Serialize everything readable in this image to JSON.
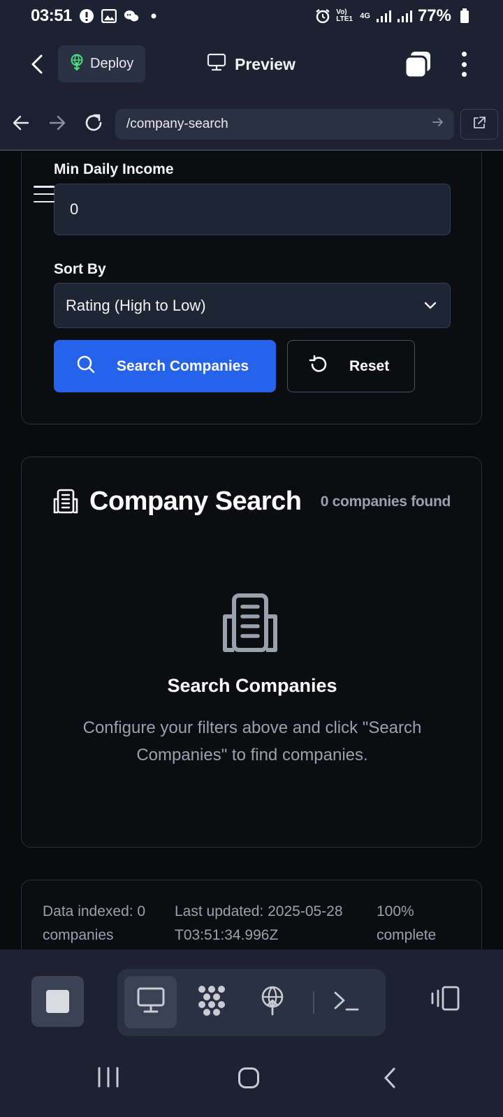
{
  "status_bar": {
    "time": "03:51",
    "signal_label": "Vo) LTE1",
    "network_type": "4G",
    "battery": "77%"
  },
  "app_header": {
    "deploy_label": "Deploy",
    "preview_label": "Preview"
  },
  "url_bar": {
    "url": "/company-search"
  },
  "filters": {
    "min_daily_income_label": "Min Daily Income",
    "min_daily_income_value": "0",
    "sort_by_label": "Sort By",
    "sort_by_value": "Rating (High to Low)",
    "search_button_label": "Search Companies",
    "reset_button_label": "Reset"
  },
  "results": {
    "title": "Company Search",
    "count_text": "0 companies found",
    "empty_title": "Search Companies",
    "empty_message": "Configure your filters above and click \"Search Companies\" to find companies."
  },
  "stats": {
    "indexed": "Data indexed: 0 companies",
    "last_updated": "Last updated: 2025-05-28T03:51:34.996Z",
    "progress": "100% complete"
  },
  "colors": {
    "accent": "#2563eb",
    "chrome_bg": "#1c2232",
    "page_bg": "#0a0b0d",
    "deploy_icon": "#4ade80"
  }
}
